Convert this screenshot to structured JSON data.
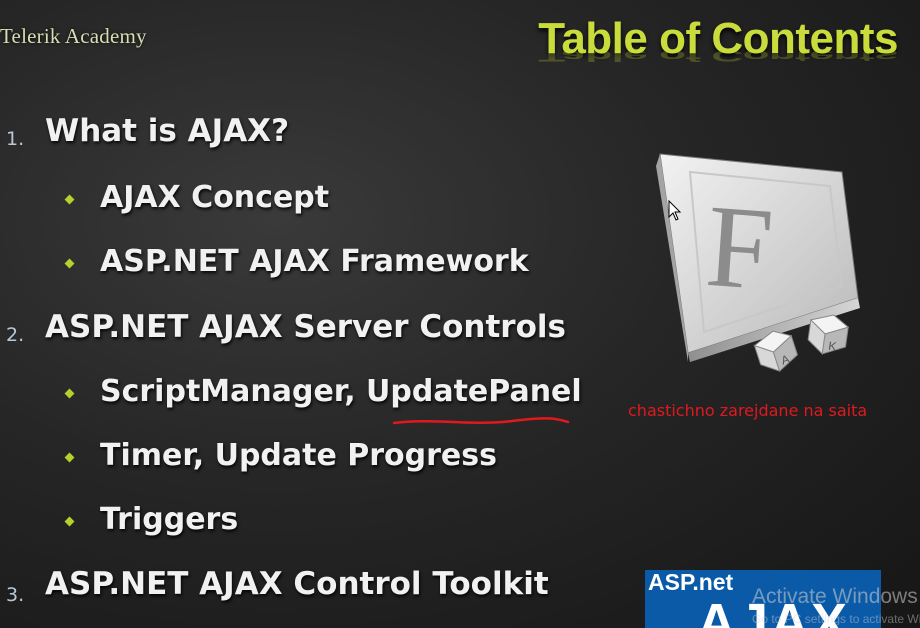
{
  "brand": {
    "logo_text": "Telerik Academy"
  },
  "slide": {
    "title": "Table of Contents",
    "sections": [
      {
        "number": "1.",
        "label": "What is AJAX?",
        "subitems": [
          "AJAX Concept",
          "ASP.NET AJAX Framework"
        ]
      },
      {
        "number": "2.",
        "label": "ASP.NET AJAX Server Controls",
        "subitems": [
          "ScriptManager, UpdatePanel",
          "Timer, Update Progress",
          "Triggers"
        ]
      },
      {
        "number": "3.",
        "label": "ASP.NET AJAX Control Toolkit",
        "subitems": []
      }
    ]
  },
  "annotation": {
    "note": "chastichno zarejdane na saita",
    "color": "#e0191f"
  },
  "asp_logo": {
    "brand": "ASP.net",
    "product": "AJAX"
  },
  "watermark": {
    "line1": "Activate Windows",
    "line2": "Go to PC settings to activate Windows."
  },
  "icons": {
    "fontbook": "font-book-icon",
    "cursor": "mouse-cursor-icon"
  },
  "colors": {
    "title": "#c9dc3c",
    "bullet": "#b8cf2c",
    "text": "#f1f1f1",
    "background": "#262626"
  }
}
